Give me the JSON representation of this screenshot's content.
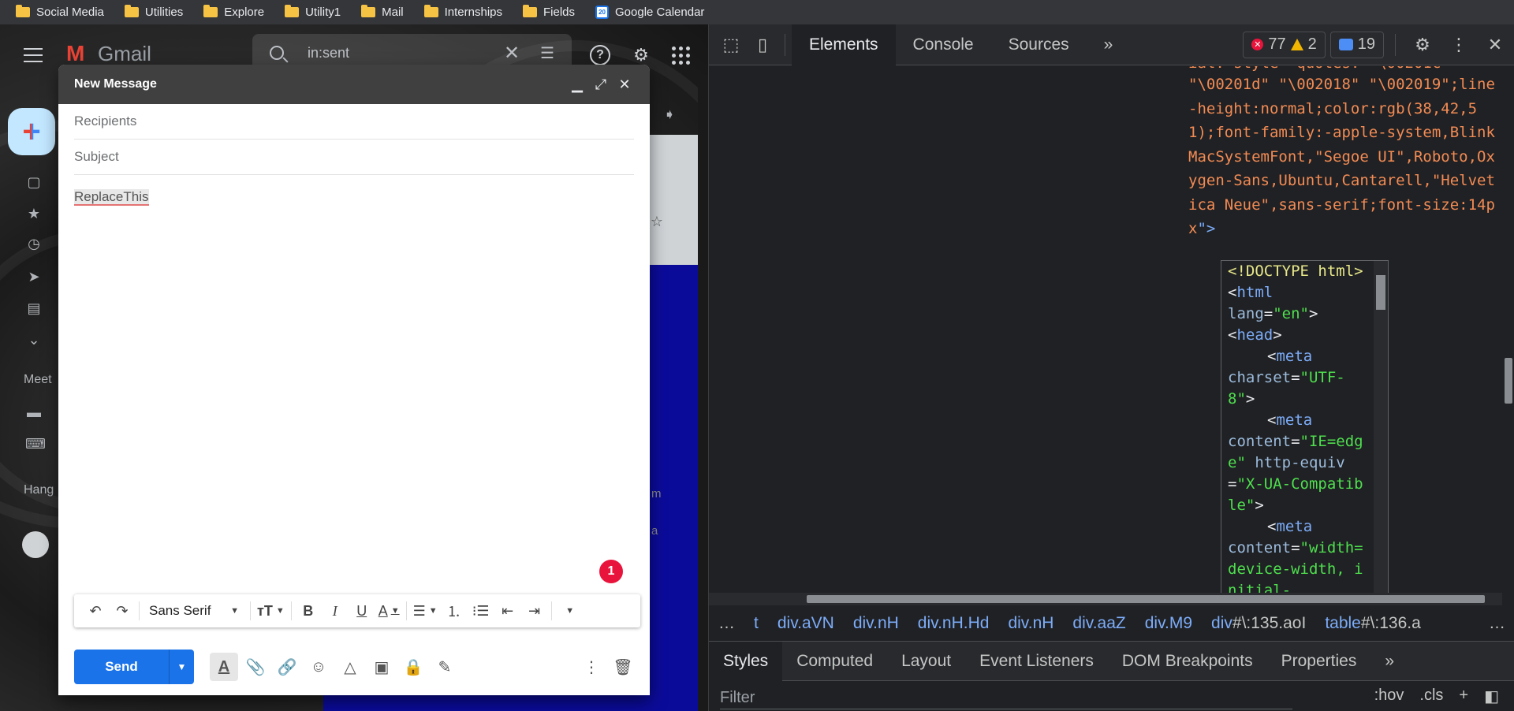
{
  "bookmarks": [
    {
      "label": "Social Media",
      "icon": "folder-icon"
    },
    {
      "label": "Utilities",
      "icon": "folder-icon"
    },
    {
      "label": "Explore",
      "icon": "folder-icon"
    },
    {
      "label": "Utility1",
      "icon": "folder-icon"
    },
    {
      "label": "Mail",
      "icon": "folder-icon"
    },
    {
      "label": "Internships",
      "icon": "folder-icon"
    },
    {
      "label": "Fields",
      "icon": "folder-icon"
    },
    {
      "label": "Google Calendar",
      "icon": "calendar-icon",
      "icon_text": "20"
    }
  ],
  "gmail": {
    "logo_text": "Gmail",
    "search_value": "in:sent",
    "side_labels": {
      "meet": "Meet",
      "hangouts": "Hang"
    },
    "list_fragments": [
      "m",
      "a"
    ]
  },
  "compose": {
    "title": "New Message",
    "recipients_placeholder": "Recipients",
    "subject_placeholder": "Subject",
    "body_text": "ReplaceThis",
    "badge_count": "1",
    "font_name": "Sans Serif",
    "send_label": "Send"
  },
  "devtools": {
    "tabs": [
      "Elements",
      "Console",
      "Sources"
    ],
    "more_tabs": "»",
    "error_count": "77",
    "warning_count": "2",
    "message_count": "19",
    "attr_text": "\"\\00201d\" \"\\002018\" \"\\002019\";line-height:normal;color:rgb(38,42,51);font-family:-apple-system,BlinkMacSystemFont,\"Segoe UI\",Roboto,Oxygen-Sans,Ubuntu,Cantarell,\"Helvetica Neue\",sans-serif;font-size:14px",
    "attr_top_partial": "ial: style=\"quotes: \"\\00201c",
    "attr_close": "\">",
    "iframe_lines": {
      "doctype": "<!DOCTYPE html>",
      "html_open": "<",
      "html_tag": "html",
      "lang_attr": "lang",
      "lang_val": "\"en\"",
      "head_tag": "head",
      "meta_tag": "meta",
      "charset_attr": "charset",
      "charset_val": "\"UTF-8\"",
      "content_attr": "content",
      "content_val1": "\"IE=edge\"",
      "http_equiv_attr": "http-equiv",
      "http_equiv_val": "\"X-UA-Compatible\"",
      "content_val2": "\"width=device-width, initial-"
    },
    "breadcrumbs": [
      {
        "label": "t"
      },
      {
        "label": "div.aVN"
      },
      {
        "label": "div.nH"
      },
      {
        "label": "div.nH.Hd"
      },
      {
        "label": "div.nH"
      },
      {
        "label": "div.aaZ"
      },
      {
        "label": "div.M9"
      },
      {
        "label_prefix": "div",
        "label_id": "#\\:135.aoI"
      },
      {
        "label_prefix": "table",
        "label_id": "#\\:136.a"
      }
    ],
    "crumb_ellipsis": "…",
    "style_tabs": [
      "Styles",
      "Computed",
      "Layout",
      "Event Listeners",
      "DOM Breakpoints",
      "Properties"
    ],
    "filter_placeholder": "Filter",
    "filter_hov": ":hov",
    "filter_cls": ".cls",
    "filter_add": "+"
  }
}
